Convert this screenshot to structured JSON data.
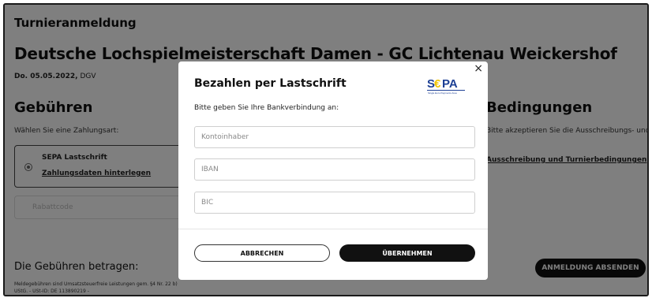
{
  "page": {
    "heading": "Turnieranmeldung",
    "event_title": "Deutsche Lochspielmeisterschaft Damen - GC Lichtenau Weickershof",
    "event_date": "Do. 05.05.2022,",
    "event_org": "DGV",
    "fees_heading": "Gebühren",
    "payment_hint": "Wählen Sie eine Zahlungsart:",
    "payment_option_label": "SEPA Lastschrift",
    "payment_option_link": "Zahlungsdaten hinterlegen",
    "discount_label": "Rabattcode",
    "conditions_heading": "Bedingungen",
    "conditions_hint": "Bitte akzeptieren Sie die Ausschreibungs- und Turnierbedingungen:",
    "conditions_link": "Ausschreibung und Turnierbedingungen",
    "fees_total_label": "Die Gebühren betragen:",
    "tax_note": "Meldegebühren sind Umsatzsteuerfreie Leistungen gem. §4 Nr. 22 b) UStG. - USt-ID: DE 113890219 -",
    "submit_label": "ANMELDUNG ABSENDEN"
  },
  "modal": {
    "title": "Bezahlen per Lastschrift",
    "close_label": "×",
    "subtitle": "Bitte geben Sie Ihre Bankverbindung an:",
    "fields": {
      "account_holder_placeholder": "Kontoinhaber",
      "iban_placeholder": "IBAN",
      "bic_placeholder": "BIC"
    },
    "cancel_label": "ABBRECHEN",
    "apply_label": "ÜBERNEHMEN",
    "logo": {
      "text": "SEPA",
      "subtext": "Single Euro Payments Area"
    }
  },
  "colors": {
    "primary_dark": "#111111",
    "overlay": "rgba(0,0,0,0.5)",
    "sepa_blue": "#1c3f94",
    "sepa_yellow": "#f2c500"
  }
}
